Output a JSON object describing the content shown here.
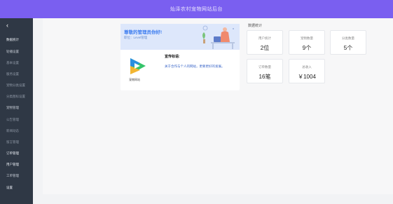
{
  "topbar": {
    "title": "灿泽农村宠物网站后台"
  },
  "sidebar": {
    "collapse_icon": "chevron-left-icon",
    "items": [
      {
        "label": "数据统计"
      },
      {
        "label": "轮播设置"
      },
      {
        "label": "基本设置"
      },
      {
        "label": "服务设置"
      },
      {
        "label": "宠物分类设置"
      },
      {
        "label": "分类图标设置"
      },
      {
        "label": "宠物管理"
      },
      {
        "label": "公告管理"
      },
      {
        "label": "新闻动态"
      },
      {
        "label": "留言管理"
      },
      {
        "label": "订单管理"
      },
      {
        "label": "用户管理"
      },
      {
        "label": "工单管理"
      },
      {
        "label": "设置"
      }
    ]
  },
  "welcome": {
    "title": "尊敬的管理员你好!",
    "role": "职位：Level管理",
    "logo_caption": "宠物网站",
    "slogan_label": "宣传标语:",
    "slogan_text": "关于合作与个人的网站，更要更好的发展。"
  },
  "stats": {
    "heading": "数据统计",
    "cards": [
      {
        "label": "用户统计",
        "value": "2位"
      },
      {
        "label": "宠物数量",
        "value": "9个"
      },
      {
        "label": "分类数量",
        "value": "5个"
      },
      {
        "label": "订单数量",
        "value": "16笔"
      },
      {
        "label": "总收入",
        "value": "￥1004"
      }
    ]
  },
  "colors": {
    "topbar": "#7a5ff0",
    "sidebar": "#2f3845",
    "accent": "#3d7df0"
  }
}
